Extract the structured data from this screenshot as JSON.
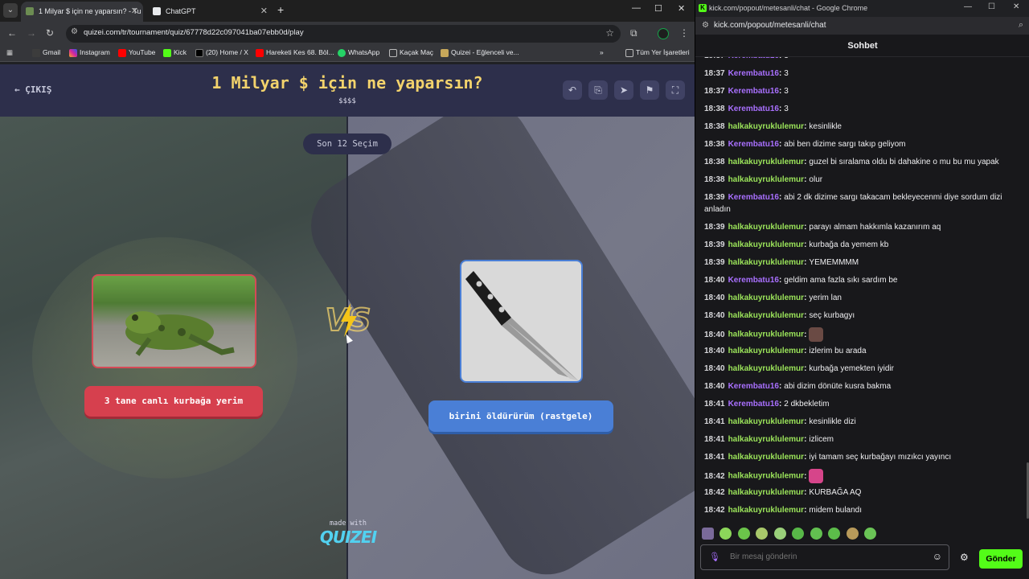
{
  "browser": {
    "tabs": [
      {
        "title": "1 Milyar $ için ne yaparsın? - Tu",
        "active": true
      },
      {
        "title": "ChatGPT",
        "active": false
      }
    ],
    "address": "quizei.com/tr/tournament/quiz/67778d22c097041ba07ebb0d/play",
    "bookmarks": [
      "Gmail",
      "Instagram",
      "YouTube",
      "Kick",
      "(20) Home / X",
      "Hareketi Kes 68. Böl...",
      "WhatsApp",
      "Kaçak Maç",
      "Quizei - Eğlenceli ve...",
      "Tüm Yer İşaretleri"
    ],
    "more_symbol": "»"
  },
  "quiz": {
    "exit_label": "ÇIKIŞ",
    "title": "1 Milyar $ için ne yaparsın?",
    "subtitle": "$$$$",
    "round_label": "Son 12 Seçim",
    "option_left": "3 tane canlı kurbağa yerim",
    "option_right": "birini öldürürüm (rastgele)",
    "vs_label": "VS",
    "made_with": "made with",
    "brand": "QUIZEI"
  },
  "popup": {
    "window_title": "kick.com/popout/metesanli/chat - Google Chrome",
    "url": "kick.com/popout/metesanli/chat",
    "chat_title": "Sohbet",
    "messages": [
      {
        "ts": "18:37",
        "user": "Kerembatu16",
        "text": "3",
        "color": "#a970ff"
      },
      {
        "ts": "18:37",
        "user": "Kerembatu16",
        "text": "3",
        "color": "#a970ff"
      },
      {
        "ts": "18:37",
        "user": "Kerembatu16",
        "text": "3",
        "color": "#a970ff"
      },
      {
        "ts": "18:38",
        "user": "Kerembatu16",
        "text": "3",
        "color": "#a970ff"
      },
      {
        "ts": "18:38",
        "user": "halkakuyruklulemur",
        "text": "kesinlikle",
        "color": "#9be45a"
      },
      {
        "ts": "18:38",
        "user": "Kerembatu16",
        "text": "abi ben dizime sargı takıp geliyom",
        "color": "#a970ff"
      },
      {
        "ts": "18:38",
        "user": "halkakuyruklulemur",
        "text": "guzel bi sıralama oldu bi dahakine o mu bu mu yapak",
        "color": "#9be45a"
      },
      {
        "ts": "18:38",
        "user": "halkakuyruklulemur",
        "text": "olur",
        "color": "#9be45a"
      },
      {
        "ts": "18:39",
        "user": "Kerembatu16",
        "text": "abi 2 dk dizime sargı takacam bekleyecenmi diye sordum dizi anladın",
        "color": "#a970ff"
      },
      {
        "ts": "18:39",
        "user": "halkakuyruklulemur",
        "text": "parayı almam hakkımla kazanırım aq",
        "color": "#9be45a"
      },
      {
        "ts": "18:39",
        "user": "halkakuyruklulemur",
        "text": "kurbağa da yemem kb",
        "color": "#9be45a"
      },
      {
        "ts": "18:39",
        "user": "halkakuyruklulemur",
        "text": "YEMEMMMM",
        "color": "#9be45a"
      },
      {
        "ts": "18:40",
        "user": "Kerembatu16",
        "text": "geldim ama fazla sıkı sardım be",
        "color": "#a970ff"
      },
      {
        "ts": "18:40",
        "user": "halkakuyruklulemur",
        "text": "yerim lan",
        "color": "#9be45a"
      },
      {
        "ts": "18:40",
        "user": "halkakuyruklulemur",
        "text": "seç kurbagyı",
        "color": "#9be45a"
      },
      {
        "ts": "18:40",
        "user": "halkakuyruklulemur",
        "text": "",
        "color": "#9be45a",
        "emote": "face-emote"
      },
      {
        "ts": "18:40",
        "user": "halkakuyruklulemur",
        "text": "izlerim bu arada",
        "color": "#9be45a"
      },
      {
        "ts": "18:40",
        "user": "halkakuyruklulemur",
        "text": "kurbağa yemekten iyidir",
        "color": "#9be45a"
      },
      {
        "ts": "18:40",
        "user": "Kerembatu16",
        "text": "abi dizim dönüte kusra bakma",
        "color": "#a970ff"
      },
      {
        "ts": "18:41",
        "user": "Kerembatu16",
        "text": "2 dkbekletim",
        "color": "#a970ff"
      },
      {
        "ts": "18:41",
        "user": "halkakuyruklulemur",
        "text": "kesinlikle dizi",
        "color": "#9be45a"
      },
      {
        "ts": "18:41",
        "user": "halkakuyruklulemur",
        "text": "izlicem",
        "color": "#9be45a"
      },
      {
        "ts": "18:41",
        "user": "halkakuyruklulemur",
        "text": "iyi tamam seç kurbağayı mızıkcı yayıncı",
        "color": "#9be45a"
      },
      {
        "ts": "18:42",
        "user": "halkakuyruklulemur",
        "text": "",
        "color": "#9be45a",
        "emote": "pink-emote"
      },
      {
        "ts": "18:42",
        "user": "halkakuyruklulemur",
        "text": "KURBAĞA AQ",
        "color": "#9be45a"
      },
      {
        "ts": "18:42",
        "user": "halkakuyruklulemur",
        "text": "midem bulandı",
        "color": "#9be45a"
      }
    ],
    "input_placeholder": "Bir mesaj gönderin",
    "send_label": "Gönder"
  },
  "colors": {
    "quiz_title": "#f3d36c",
    "option_left": "#d6404e",
    "option_right": "#4a7fd6",
    "kick_green": "#53fc18",
    "user_purple": "#a970ff",
    "user_green": "#9be45a"
  },
  "icons": [
    "tab-search-icon",
    "back-icon",
    "forward-icon",
    "reload-icon",
    "site-info-icon",
    "star-icon",
    "extensions-icon",
    "profile-icon",
    "menu-icon",
    "apps-icon",
    "arrow-left-icon",
    "undo-icon",
    "share-icon",
    "send-icon",
    "flag-icon",
    "fullscreen-icon",
    "mic-icon",
    "emoji-icon",
    "gear-icon",
    "zoom-icon"
  ]
}
